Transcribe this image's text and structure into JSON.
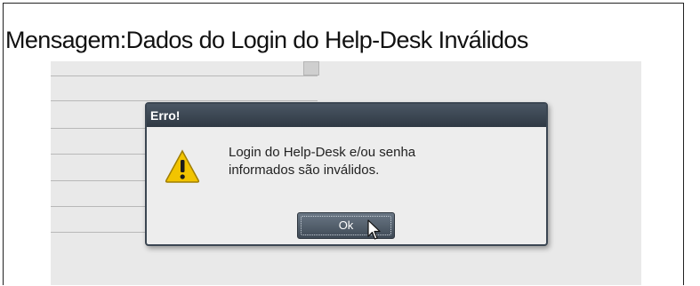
{
  "caption": {
    "text": "Mensagem:Dados do Login do Help-Desk Inválidos"
  },
  "dialog": {
    "title": "Erro!",
    "message_line1": "Login do Help-Desk e/ou senha",
    "message_line2": "informados são inválidos.",
    "ok_label": "Ok",
    "icon": "warning-icon"
  },
  "colors": {
    "titlebar": "#3b4652",
    "dialog_bg": "#ededed",
    "screen_bg": "#e9e9e9",
    "warning_yellow": "#f2c400"
  }
}
